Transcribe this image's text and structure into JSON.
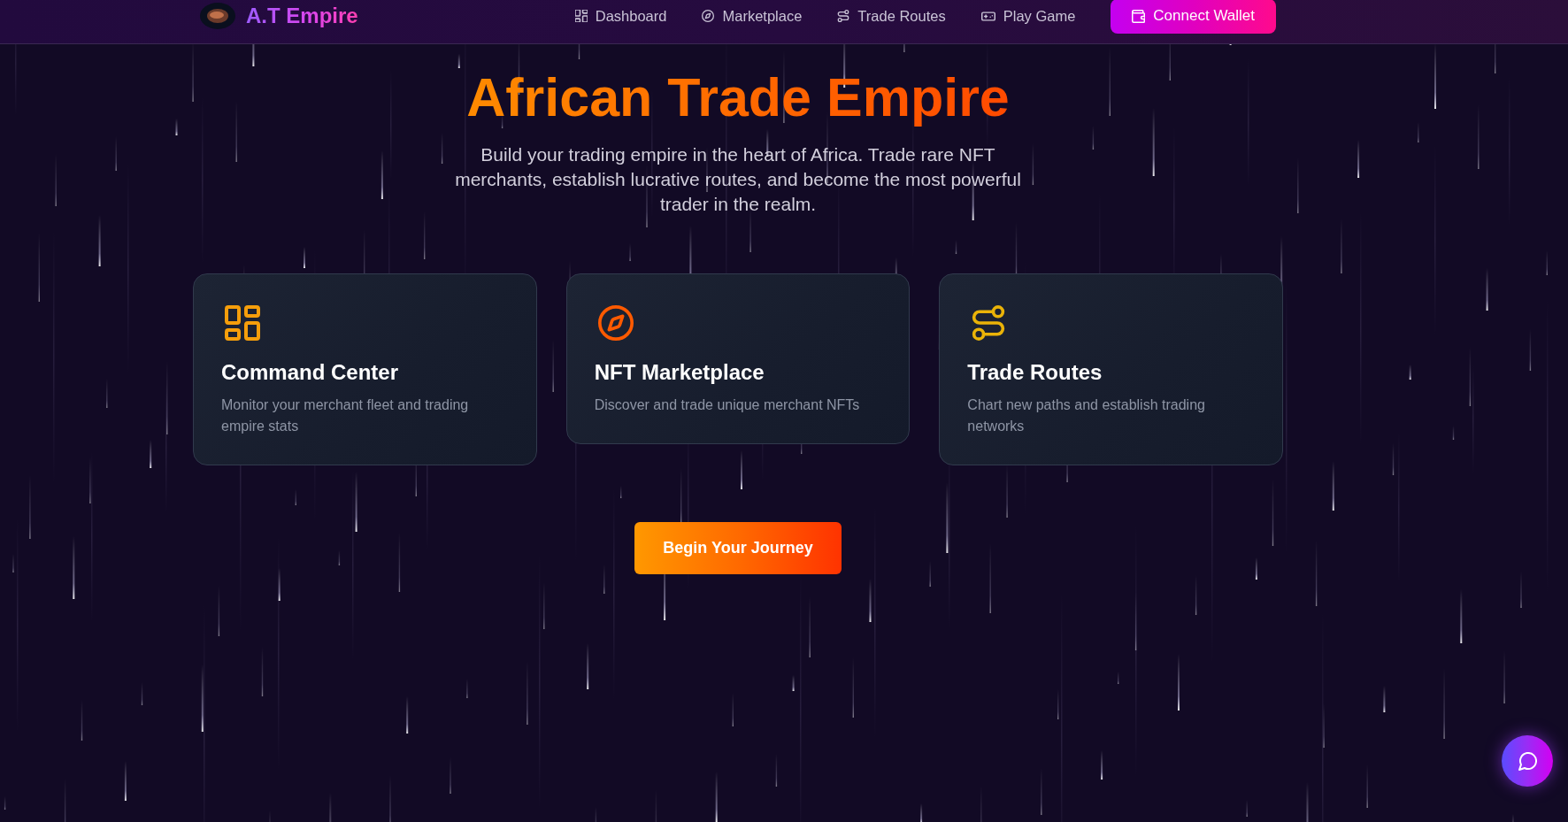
{
  "header": {
    "brand": "A.T Empire",
    "nav": [
      {
        "label": "Dashboard"
      },
      {
        "label": "Marketplace"
      },
      {
        "label": "Trade Routes"
      },
      {
        "label": "Play Game"
      }
    ],
    "connect_button": "Connect Wallet"
  },
  "hero": {
    "title": "African Trade Empire",
    "subtitle": "Build your trading empire in the heart of Africa. Trade rare NFT merchants, establish lucrative routes, and become the most powerful trader in the realm."
  },
  "features": [
    {
      "title": "Command Center",
      "description": "Monitor your merchant fleet and trading empire stats",
      "color": "#f59e0b"
    },
    {
      "title": "NFT Marketplace",
      "description": "Discover and trade unique merchant NFTs",
      "color": "#ff5a00"
    },
    {
      "title": "Trade Routes",
      "description": "Chart new paths and establish trading networks",
      "color": "#eab308"
    }
  ],
  "cta_button": "Begin Your Journey"
}
